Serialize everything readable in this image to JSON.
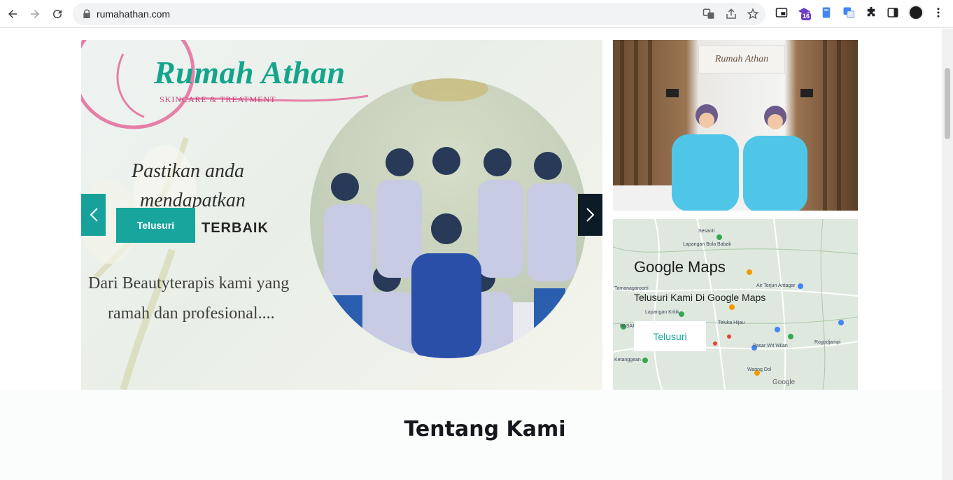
{
  "browser": {
    "url": "rumahathan.com",
    "extension_badge": "16"
  },
  "carousel": {
    "brand": "Rumah Athan",
    "brand_sub": "SKINCARE & TREATMENT",
    "script_line_1": "Pastikan anda",
    "script_line_2": "mendapatkan",
    "headline_word": "TERBAIK",
    "body_line_1": "Dari Beautyterapis kami yang",
    "body_line_2": "ramah dan profesional....",
    "cta_label": "Telusuri",
    "prev_icon": "chevron-left-icon",
    "next_icon": "chevron-right-icon"
  },
  "photo_card": {
    "logo_text": "Rumah Athan"
  },
  "map_card": {
    "title": "Google Maps",
    "subtitle": "Telusuri Kami Di Google Maps",
    "button_label": "Telusuri",
    "labels": [
      "Sesanti",
      "Lapangan Bola Babak",
      "Tamanagaroorti",
      "Air Terjun Antagar",
      "Lapangan Kritik",
      "Teluka Hijau",
      "PASAR",
      "Rogodjampi",
      "Pasar Wit Wilan",
      "Ketanggean",
      "Waring Dol",
      "Google"
    ]
  },
  "section": {
    "title": "Tentang Kami"
  },
  "colors": {
    "teal": "#17a59d",
    "brand_green": "#13a58b",
    "navy": "#0c1b26"
  }
}
